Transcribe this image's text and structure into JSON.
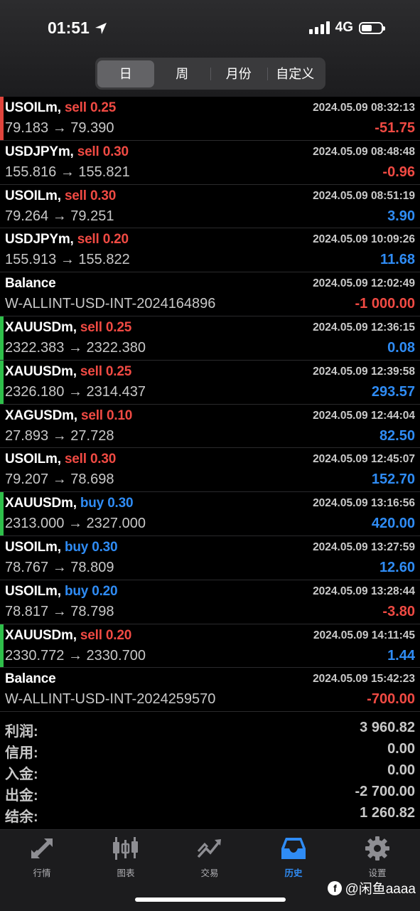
{
  "status": {
    "time": "01:51",
    "network": "4G"
  },
  "segments": [
    "日",
    "周",
    "月份",
    "自定义"
  ],
  "active_segment": 0,
  "rows": [
    {
      "symbol": "USOILm,",
      "side": "sell",
      "volume": "0.25",
      "time": "2024.05.09 08:32:13",
      "prices": "79.183 → 79.390",
      "profit": "-51.75",
      "sign": "neg",
      "bar": "#e0443c"
    },
    {
      "symbol": "USDJPYm,",
      "side": "sell",
      "volume": "0.30",
      "time": "2024.05.09 08:48:48",
      "prices": "155.816 → 155.821",
      "profit": "-0.96",
      "sign": "neg",
      "bar": ""
    },
    {
      "symbol": "USOILm,",
      "side": "sell",
      "volume": "0.30",
      "time": "2024.05.09 08:51:19",
      "prices": "79.264 → 79.251",
      "profit": "3.90",
      "sign": "pos",
      "bar": ""
    },
    {
      "symbol": "USDJPYm,",
      "side": "sell",
      "volume": "0.20",
      "time": "2024.05.09 10:09:26",
      "prices": "155.913 → 155.822",
      "profit": "11.68",
      "sign": "pos",
      "bar": ""
    },
    {
      "symbol": "Balance",
      "side": "",
      "volume": "",
      "time": "2024.05.09 12:02:49",
      "prices": "W-ALLINT-USD-INT-2024164896",
      "profit": "-1 000.00",
      "sign": "neg",
      "bar": ""
    },
    {
      "symbol": "XAUUSDm,",
      "side": "sell",
      "volume": "0.25",
      "time": "2024.05.09 12:36:15",
      "prices": "2322.383 → 2322.380",
      "profit": "0.08",
      "sign": "pos",
      "bar": "#2fbf4a"
    },
    {
      "symbol": "XAUUSDm,",
      "side": "sell",
      "volume": "0.25",
      "time": "2024.05.09 12:39:58",
      "prices": "2326.180 → 2314.437",
      "profit": "293.57",
      "sign": "pos",
      "bar": "#2fbf4a"
    },
    {
      "symbol": "XAGUSDm,",
      "side": "sell",
      "volume": "0.10",
      "time": "2024.05.09 12:44:04",
      "prices": "27.893 → 27.728",
      "profit": "82.50",
      "sign": "pos",
      "bar": ""
    },
    {
      "symbol": "USOILm,",
      "side": "sell",
      "volume": "0.30",
      "time": "2024.05.09 12:45:07",
      "prices": "79.207 → 78.698",
      "profit": "152.70",
      "sign": "pos",
      "bar": ""
    },
    {
      "symbol": "XAUUSDm,",
      "side": "buy",
      "volume": "0.30",
      "time": "2024.05.09 13:16:56",
      "prices": "2313.000 → 2327.000",
      "profit": "420.00",
      "sign": "pos",
      "bar": "#2fbf4a"
    },
    {
      "symbol": "USOILm,",
      "side": "buy",
      "volume": "0.30",
      "time": "2024.05.09 13:27:59",
      "prices": "78.767 → 78.809",
      "profit": "12.60",
      "sign": "pos",
      "bar": ""
    },
    {
      "symbol": "USOILm,",
      "side": "buy",
      "volume": "0.20",
      "time": "2024.05.09 13:28:44",
      "prices": "78.817 → 78.798",
      "profit": "-3.80",
      "sign": "neg",
      "bar": ""
    },
    {
      "symbol": "XAUUSDm,",
      "side": "sell",
      "volume": "0.20",
      "time": "2024.05.09 14:11:45",
      "prices": "2330.772 → 2330.700",
      "profit": "1.44",
      "sign": "pos",
      "bar": "#2fbf4a"
    },
    {
      "symbol": "Balance",
      "side": "",
      "volume": "",
      "time": "2024.05.09 15:42:23",
      "prices": "W-ALLINT-USD-INT-2024259570",
      "profit": "-700.00",
      "sign": "neg",
      "bar": ""
    }
  ],
  "summary": [
    {
      "label": "利润:",
      "value": "3 960.82"
    },
    {
      "label": "信用:",
      "value": "0.00"
    },
    {
      "label": "入金:",
      "value": "0.00"
    },
    {
      "label": "出金:",
      "value": "-2 700.00"
    },
    {
      "label": "结余:",
      "value": "1 260.82"
    }
  ],
  "tabs": [
    {
      "label": "行情",
      "icon": "quotes-icon"
    },
    {
      "label": "图表",
      "icon": "chart-icon"
    },
    {
      "label": "交易",
      "icon": "trade-icon"
    },
    {
      "label": "历史",
      "icon": "history-icon"
    },
    {
      "label": "设置",
      "icon": "settings-icon"
    }
  ],
  "active_tab": 3,
  "watermark": "@闲鱼aaaa",
  "colors": {
    "sell": "#f04a43",
    "buy": "#2f8cf5",
    "active_tab": "#2f8cf5"
  }
}
